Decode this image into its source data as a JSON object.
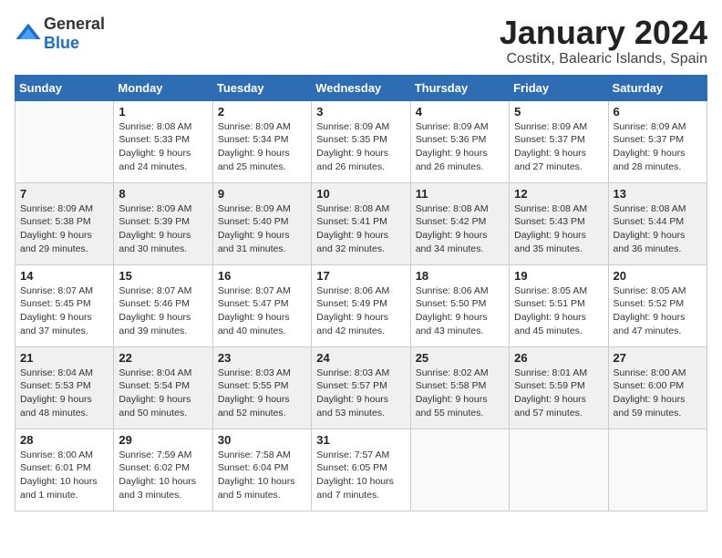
{
  "logo": {
    "general": "General",
    "blue": "Blue"
  },
  "title": "January 2024",
  "location": "Costitx, Balearic Islands, Spain",
  "days_of_week": [
    "Sunday",
    "Monday",
    "Tuesday",
    "Wednesday",
    "Thursday",
    "Friday",
    "Saturday"
  ],
  "weeks": [
    [
      {
        "day": "",
        "info": ""
      },
      {
        "day": "1",
        "info": "Sunrise: 8:08 AM\nSunset: 5:33 PM\nDaylight: 9 hours\nand 24 minutes."
      },
      {
        "day": "2",
        "info": "Sunrise: 8:09 AM\nSunset: 5:34 PM\nDaylight: 9 hours\nand 25 minutes."
      },
      {
        "day": "3",
        "info": "Sunrise: 8:09 AM\nSunset: 5:35 PM\nDaylight: 9 hours\nand 26 minutes."
      },
      {
        "day": "4",
        "info": "Sunrise: 8:09 AM\nSunset: 5:36 PM\nDaylight: 9 hours\nand 26 minutes."
      },
      {
        "day": "5",
        "info": "Sunrise: 8:09 AM\nSunset: 5:37 PM\nDaylight: 9 hours\nand 27 minutes."
      },
      {
        "day": "6",
        "info": "Sunrise: 8:09 AM\nSunset: 5:37 PM\nDaylight: 9 hours\nand 28 minutes."
      }
    ],
    [
      {
        "day": "7",
        "info": "Sunrise: 8:09 AM\nSunset: 5:38 PM\nDaylight: 9 hours\nand 29 minutes."
      },
      {
        "day": "8",
        "info": "Sunrise: 8:09 AM\nSunset: 5:39 PM\nDaylight: 9 hours\nand 30 minutes."
      },
      {
        "day": "9",
        "info": "Sunrise: 8:09 AM\nSunset: 5:40 PM\nDaylight: 9 hours\nand 31 minutes."
      },
      {
        "day": "10",
        "info": "Sunrise: 8:08 AM\nSunset: 5:41 PM\nDaylight: 9 hours\nand 32 minutes."
      },
      {
        "day": "11",
        "info": "Sunrise: 8:08 AM\nSunset: 5:42 PM\nDaylight: 9 hours\nand 34 minutes."
      },
      {
        "day": "12",
        "info": "Sunrise: 8:08 AM\nSunset: 5:43 PM\nDaylight: 9 hours\nand 35 minutes."
      },
      {
        "day": "13",
        "info": "Sunrise: 8:08 AM\nSunset: 5:44 PM\nDaylight: 9 hours\nand 36 minutes."
      }
    ],
    [
      {
        "day": "14",
        "info": "Sunrise: 8:07 AM\nSunset: 5:45 PM\nDaylight: 9 hours\nand 37 minutes."
      },
      {
        "day": "15",
        "info": "Sunrise: 8:07 AM\nSunset: 5:46 PM\nDaylight: 9 hours\nand 39 minutes."
      },
      {
        "day": "16",
        "info": "Sunrise: 8:07 AM\nSunset: 5:47 PM\nDaylight: 9 hours\nand 40 minutes."
      },
      {
        "day": "17",
        "info": "Sunrise: 8:06 AM\nSunset: 5:49 PM\nDaylight: 9 hours\nand 42 minutes."
      },
      {
        "day": "18",
        "info": "Sunrise: 8:06 AM\nSunset: 5:50 PM\nDaylight: 9 hours\nand 43 minutes."
      },
      {
        "day": "19",
        "info": "Sunrise: 8:05 AM\nSunset: 5:51 PM\nDaylight: 9 hours\nand 45 minutes."
      },
      {
        "day": "20",
        "info": "Sunrise: 8:05 AM\nSunset: 5:52 PM\nDaylight: 9 hours\nand 47 minutes."
      }
    ],
    [
      {
        "day": "21",
        "info": "Sunrise: 8:04 AM\nSunset: 5:53 PM\nDaylight: 9 hours\nand 48 minutes."
      },
      {
        "day": "22",
        "info": "Sunrise: 8:04 AM\nSunset: 5:54 PM\nDaylight: 9 hours\nand 50 minutes."
      },
      {
        "day": "23",
        "info": "Sunrise: 8:03 AM\nSunset: 5:55 PM\nDaylight: 9 hours\nand 52 minutes."
      },
      {
        "day": "24",
        "info": "Sunrise: 8:03 AM\nSunset: 5:57 PM\nDaylight: 9 hours\nand 53 minutes."
      },
      {
        "day": "25",
        "info": "Sunrise: 8:02 AM\nSunset: 5:58 PM\nDaylight: 9 hours\nand 55 minutes."
      },
      {
        "day": "26",
        "info": "Sunrise: 8:01 AM\nSunset: 5:59 PM\nDaylight: 9 hours\nand 57 minutes."
      },
      {
        "day": "27",
        "info": "Sunrise: 8:00 AM\nSunset: 6:00 PM\nDaylight: 9 hours\nand 59 minutes."
      }
    ],
    [
      {
        "day": "28",
        "info": "Sunrise: 8:00 AM\nSunset: 6:01 PM\nDaylight: 10 hours\nand 1 minute."
      },
      {
        "day": "29",
        "info": "Sunrise: 7:59 AM\nSunset: 6:02 PM\nDaylight: 10 hours\nand 3 minutes."
      },
      {
        "day": "30",
        "info": "Sunrise: 7:58 AM\nSunset: 6:04 PM\nDaylight: 10 hours\nand 5 minutes."
      },
      {
        "day": "31",
        "info": "Sunrise: 7:57 AM\nSunset: 6:05 PM\nDaylight: 10 hours\nand 7 minutes."
      },
      {
        "day": "",
        "info": ""
      },
      {
        "day": "",
        "info": ""
      },
      {
        "day": "",
        "info": ""
      }
    ]
  ]
}
